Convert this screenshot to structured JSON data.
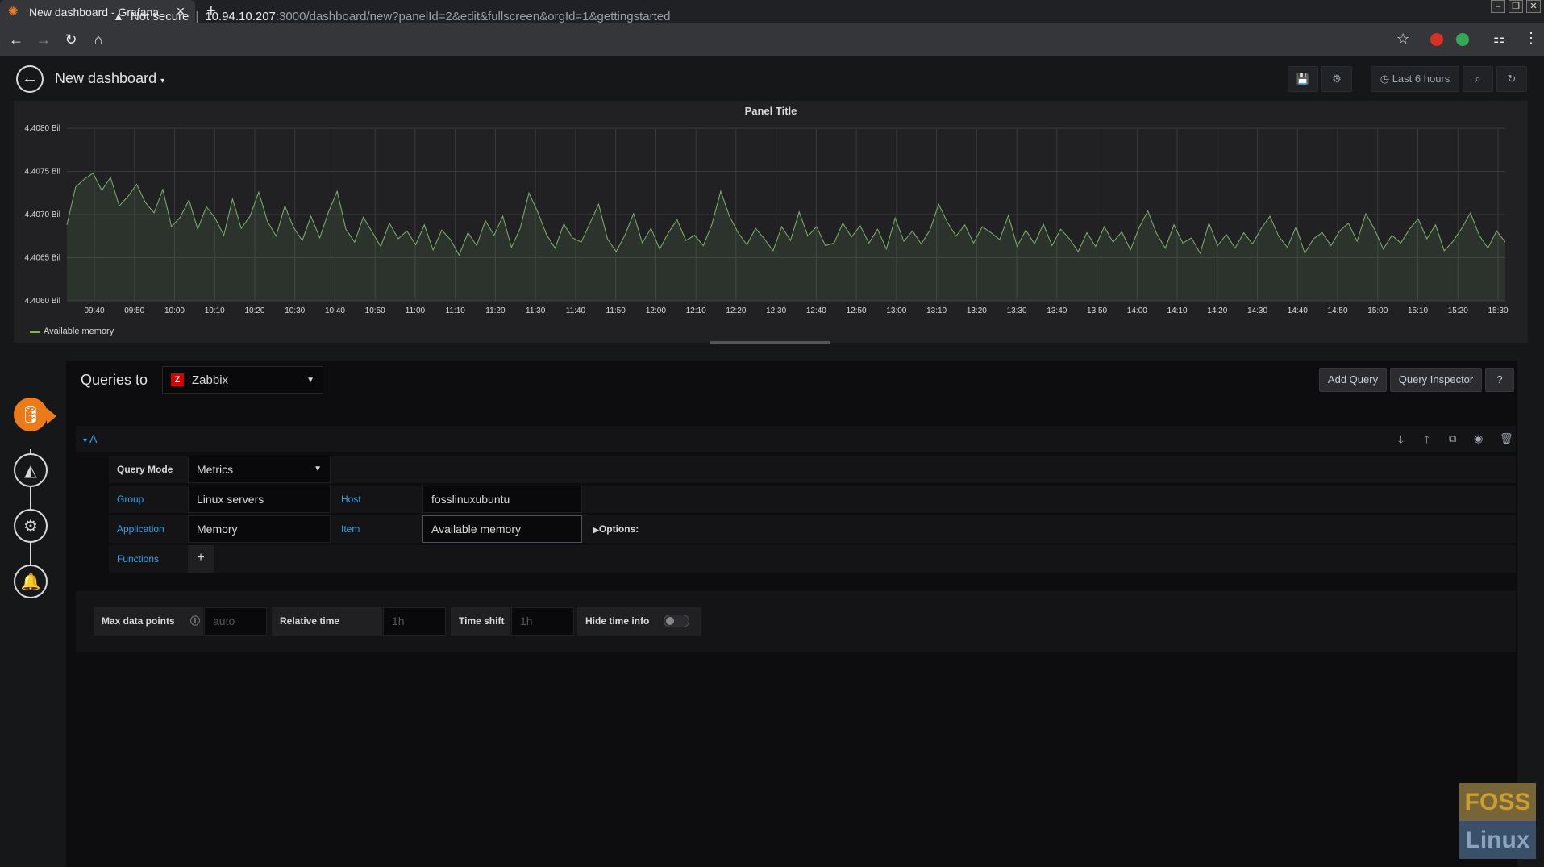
{
  "browser": {
    "tab_title": "New dashboard - Grafana",
    "security_label": "Not secure",
    "url_host": "10.94.10.207",
    "url_path": ":3000/dashboard/new?panelId=2&edit&fullscreen&orgId=1&gettingstarted"
  },
  "header": {
    "dashboard_title": "New dashboard",
    "time_range": "Last 6 hours",
    "icons": [
      "save-icon",
      "settings-icon",
      "clock-icon",
      "zoom-out-icon",
      "refresh-icon"
    ]
  },
  "panel": {
    "title": "Panel Title",
    "legend": "Available memory"
  },
  "chart_data": {
    "type": "line",
    "title": "Panel Title",
    "series": [
      {
        "name": "Available memory",
        "color": "#7eb26d",
        "values": [
          4.40688,
          4.40732,
          4.40741,
          4.40748,
          4.40728,
          4.40743,
          4.4071,
          4.40721,
          4.40735,
          4.40714,
          4.40702,
          4.40729,
          4.40686,
          4.40697,
          4.40717,
          4.40683,
          4.40709,
          4.40696,
          4.40676,
          4.40718,
          4.40684,
          4.40698,
          4.40726,
          4.40692,
          4.40675,
          4.4071,
          4.40685,
          4.4067,
          4.40698,
          4.40673,
          4.40703,
          4.40727,
          4.40683,
          4.40668,
          4.40697,
          4.4068,
          4.40663,
          4.4069,
          4.40672,
          4.40681,
          4.40665,
          4.40688,
          4.40659,
          4.40682,
          4.40671,
          4.40653,
          4.40679,
          4.40664,
          4.40693,
          4.40676,
          4.40698,
          4.40662,
          4.40684,
          4.40725,
          4.40703,
          4.40677,
          4.40661,
          4.40689,
          4.40673,
          4.40668,
          4.4069,
          4.40712,
          4.40672,
          4.40657,
          4.40676,
          4.40701,
          4.40667,
          4.40684,
          4.4066,
          4.40679,
          4.40694,
          4.4067,
          4.40676,
          4.40664,
          4.40689,
          4.40727,
          4.40698,
          4.40679,
          4.40665,
          4.40684,
          4.40672,
          4.40658,
          4.40686,
          4.4067,
          4.40703,
          4.40675,
          4.40686,
          4.40664,
          4.40667,
          4.4069,
          4.40674,
          4.40687,
          4.40667,
          4.40683,
          4.4066,
          4.40696,
          4.40669,
          4.40681,
          4.40666,
          4.40682,
          4.40712,
          4.40691,
          4.40675,
          4.40688,
          4.40667,
          4.40686,
          4.40679,
          4.40671,
          4.40699,
          4.40663,
          4.40682,
          4.40666,
          4.40689,
          4.40664,
          4.40683,
          4.40672,
          4.40657,
          4.40679,
          4.40663,
          4.40686,
          4.40668,
          4.4068,
          4.40659,
          4.40685,
          4.40704,
          4.40678,
          4.40661,
          4.40688,
          4.40667,
          4.40673,
          4.40655,
          4.4069,
          4.40664,
          4.40677,
          4.40661,
          4.40679,
          4.40666,
          4.40684,
          4.40698,
          4.40675,
          4.40662,
          4.40686,
          4.40655,
          4.40672,
          4.40679,
          4.40664,
          4.40681,
          4.4069,
          4.40669,
          4.40701,
          4.40683,
          4.4066,
          4.40676,
          4.40667,
          4.40683,
          4.40695,
          4.40672,
          4.40688,
          4.40658,
          4.40669,
          4.40684,
          4.40702,
          4.40676,
          4.40661,
          4.40681,
          4.40668
        ]
      }
    ],
    "x_ticks": [
      "09:40",
      "09:50",
      "10:00",
      "10:10",
      "10:20",
      "10:30",
      "10:40",
      "10:50",
      "11:00",
      "11:10",
      "11:20",
      "11:30",
      "11:40",
      "11:50",
      "12:00",
      "12:10",
      "12:20",
      "12:30",
      "12:40",
      "12:50",
      "13:00",
      "13:10",
      "13:20",
      "13:30",
      "13:40",
      "13:50",
      "14:00",
      "14:10",
      "14:20",
      "14:30",
      "14:40",
      "14:50",
      "15:00",
      "15:10",
      "15:20",
      "15:30"
    ],
    "y_ticks": [
      "4.4060 Bil",
      "4.4065 Bil",
      "4.4070 Bil",
      "4.4075 Bil",
      "4.4080 Bil"
    ],
    "ylim": [
      4.406,
      4.408
    ],
    "y_unit": "Bil",
    "grid": true,
    "legend_position": "bottom-left"
  },
  "editor": {
    "queries_to_label": "Queries to",
    "datasource": "Zabbix",
    "datasource_logo": "Z",
    "add_query": "Add Query",
    "query_inspector": "Query Inspector",
    "help": "?",
    "query_letter": "A",
    "query_mode_label": "Query Mode",
    "query_mode_value": "Metrics",
    "group_label": "Group",
    "group_value": "Linux servers",
    "host_label": "Host",
    "host_value": "fosslinuxubuntu",
    "application_label": "Application",
    "application_value": "Memory",
    "item_label": "Item",
    "item_value": "Available memory",
    "options_label": "Options:",
    "functions_label": "Functions",
    "max_data_points_label": "Max data points",
    "max_data_points_placeholder": "auto",
    "relative_time_label": "Relative time",
    "relative_time_placeholder": "1h",
    "time_shift_label": "Time shift",
    "time_shift_placeholder": "1h",
    "hide_time_info_label": "Hide time info",
    "hide_time_info": false
  },
  "watermark": {
    "top": "FOSS",
    "bottom": "Linux"
  }
}
